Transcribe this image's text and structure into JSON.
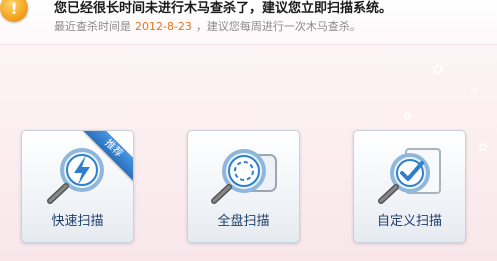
{
  "header": {
    "title": "您已经很长时间未进行木马查杀了，建议您立即扫描系统。",
    "subline_prefix": "最近查杀时间是",
    "last_scan_date": "2012-8-23",
    "subline_suffix": "，建议您每周进行一次木马查杀。",
    "icon": "warning-icon"
  },
  "scan_options": [
    {
      "label": "快速扫描",
      "icon": "quick-scan-icon",
      "badge": "推荐"
    },
    {
      "label": "全盘扫描",
      "icon": "full-disk-scan-icon"
    },
    {
      "label": "自定义扫描",
      "icon": "custom-scan-icon"
    }
  ],
  "colors": {
    "accent_date": "#e2761b",
    "label_text": "#1f3f6a",
    "badge_bg": "#2a6fc0"
  }
}
